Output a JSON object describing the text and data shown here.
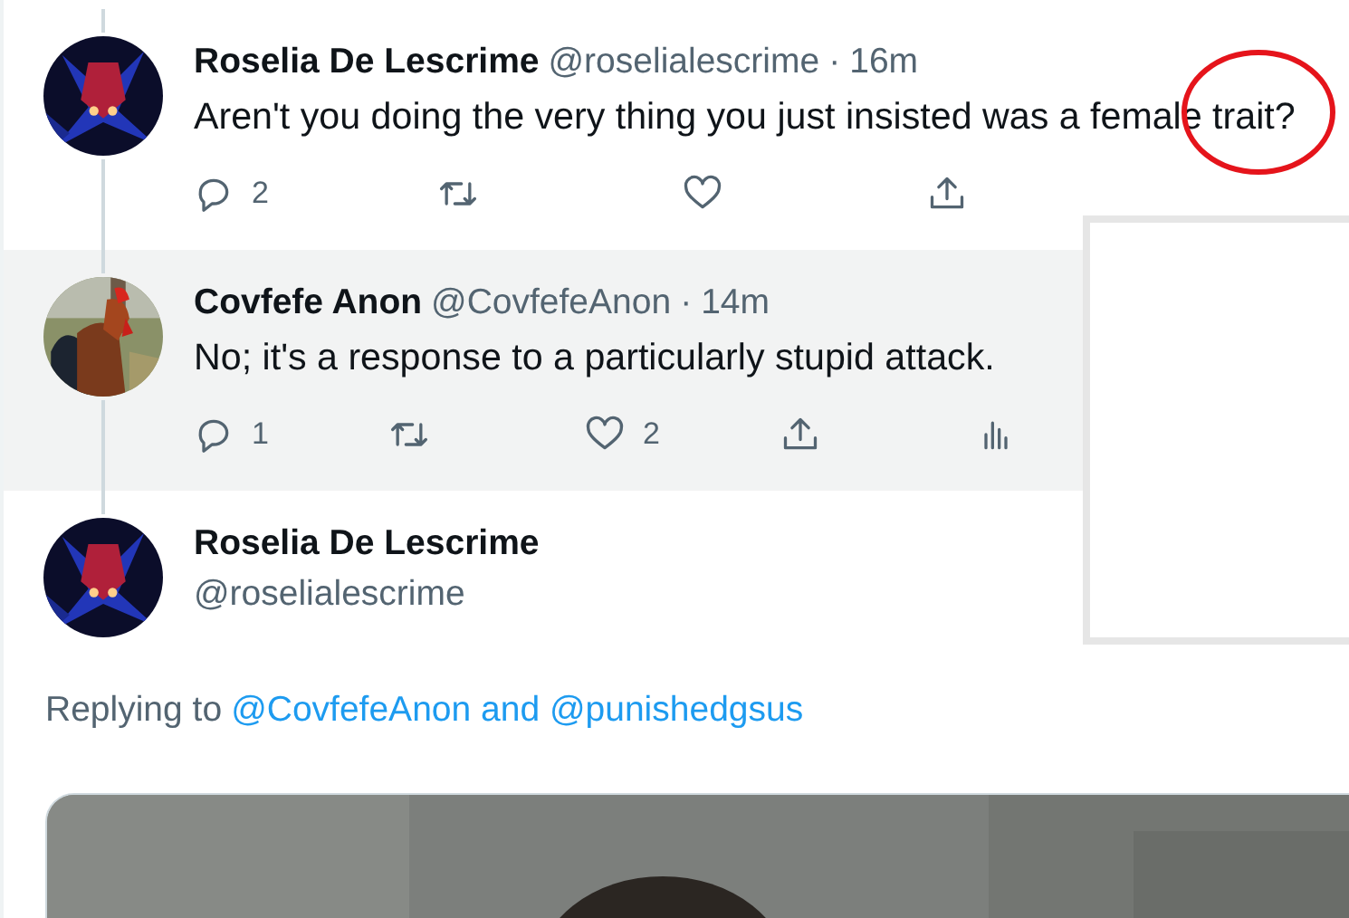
{
  "thread": [
    {
      "name": "Roselia De Lescrime",
      "handle": "@roselialescrime",
      "separator": "·",
      "time": "16m",
      "text": "Aren't you doing the very thing you just insisted was a female trait?",
      "highlighted": false,
      "avatar": {
        "kind": "picture"
      },
      "actions": [
        {
          "kind": "reply",
          "count": "2"
        },
        {
          "kind": "retweet"
        },
        {
          "kind": "like"
        },
        {
          "kind": "share"
        }
      ]
    },
    {
      "name": "Covfefe Anon",
      "handle": "@CovfefeAnon",
      "separator": "·",
      "time": "14m",
      "text": "No; it's a response to a particularly stupid attack.",
      "highlighted": true,
      "avatar": {
        "kind": "picture"
      },
      "actions": [
        {
          "kind": "reply",
          "count": "1"
        },
        {
          "kind": "retweet"
        },
        {
          "kind": "like",
          "count": "2"
        },
        {
          "kind": "share"
        },
        {
          "kind": "analytics"
        }
      ]
    }
  ],
  "main_tweet": {
    "name": "Roselia De Lescrime",
    "handle": "@roselialescrime",
    "avatar": {
      "kind": "picture"
    },
    "replying": {
      "prefix": "Replying to",
      "mentions": "@CovfefeAnon and @punishedgsus"
    },
    "media": {
      "kind": "picture"
    }
  },
  "overlay_panel": {
    "kind": "blank"
  },
  "annotation": {
    "kind": "circle",
    "color": "#e5141b"
  }
}
